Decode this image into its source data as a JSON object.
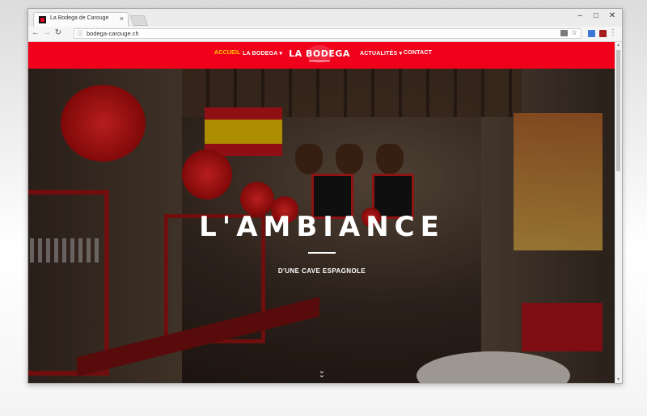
{
  "browser": {
    "tab_title": "La Bodega de Carouge",
    "tab_close": "×",
    "url": "bodega-carouge.ch",
    "controls": {
      "minimize": "–",
      "maximize": "□",
      "close": "✕"
    },
    "nav": {
      "back": "←",
      "forward": "→",
      "reload": "↻"
    },
    "star": "☆",
    "menu": "⋮"
  },
  "site": {
    "nav_left": [
      "ACCUEIL",
      "LA BODEGA ▾"
    ],
    "nav_right": [
      "ACTUALITÉS ▾",
      "CONTACT"
    ],
    "logo": "LA BODEGA",
    "accent_color": "#f0001b",
    "active_color": "#ffd400"
  },
  "hero": {
    "title": "L'AMBIANCE",
    "subtitle": "D'UNE CAVE ESPAGNOLE",
    "scroll_icon": "chevron-double-down-icon",
    "scroll_glyph": "⌄\n⌄"
  }
}
